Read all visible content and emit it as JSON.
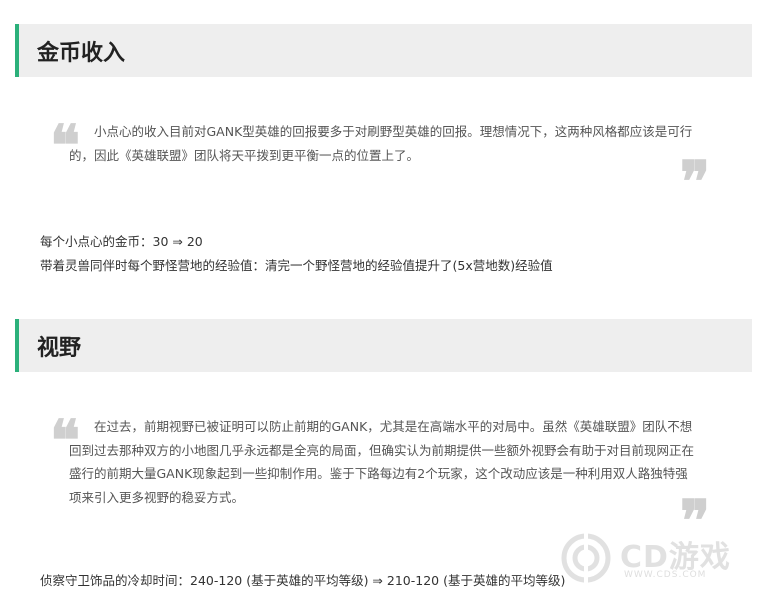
{
  "sections": [
    {
      "title": "金币收入",
      "quote": "小点心的收入目前对GANK型英雄的回报要多于对刷野型英雄的回报。理想情况下，这两种风格都应该是可行的，因此《英雄联盟》团队将天平拨到更平衡一点的位置上了。",
      "lines": [
        "每个小点心的金币：30 ⇒ 20",
        "带着灵兽同伴时每个野怪营地的经验值：清完一个野怪营地的经验值提升了(5x营地数)经验值"
      ]
    },
    {
      "title": "视野",
      "quote": "在过去，前期视野已被证明可以防止前期的GANK，尤其是在高端水平的对局中。虽然《英雄联盟》团队不想回到过去那种双方的小地图几乎永远都是全亮的局面，但确实认为前期提供一些额外视野会有助于对目前现网正在盛行的前期大量GANK现象起到一些抑制作用。鉴于下路每边有2个玩家，这个改动应该是一种利用双人路独特强项来引入更多视野的稳妥方式。",
      "lines": [
        "侦察守卫饰品的冷却时间：240-120 (基于英雄的平均等级) ⇒ 210-120 (基于英雄的平均等级)"
      ]
    }
  ],
  "quote_marks": {
    "open": "❝",
    "close": "❞"
  },
  "watermark": {
    "text": "CD游戏",
    "url": "WWW.CDS.COM",
    "logo_icon": "cd-logo-icon"
  },
  "colors": {
    "accent": "#2bb07a",
    "header_bg": "#eeeeee",
    "quote_mark": "#cfcfcf"
  }
}
